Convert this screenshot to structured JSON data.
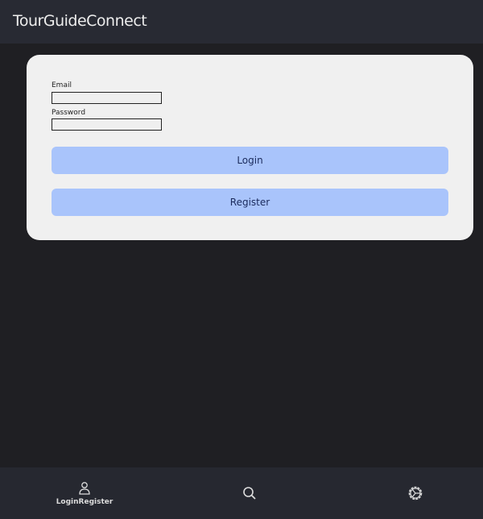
{
  "header": {
    "title": "TourGuideConnect"
  },
  "form": {
    "email_label": "Email",
    "email_value": "",
    "password_label": "Password",
    "password_value": "",
    "login_label": "Login",
    "register_label": "Register"
  },
  "nav": {
    "items": [
      {
        "label": "LoginRegister",
        "icon": "person-icon"
      },
      {
        "icon": "search-icon"
      },
      {
        "icon": "settings-icon"
      }
    ]
  }
}
